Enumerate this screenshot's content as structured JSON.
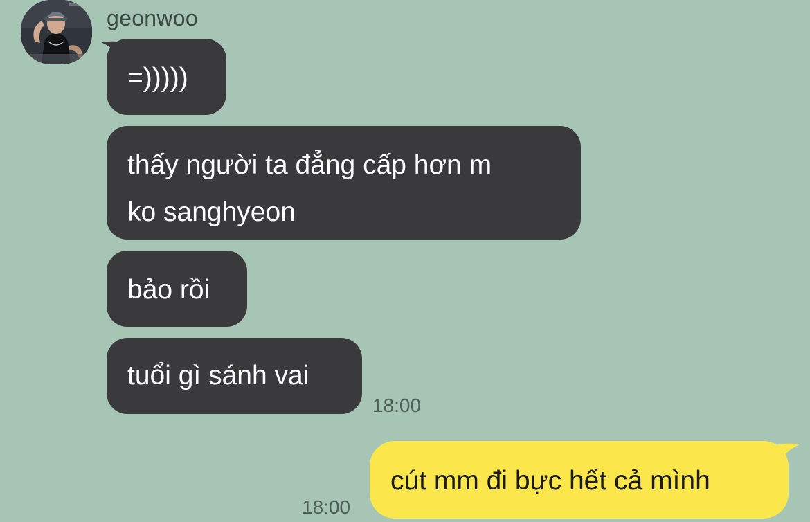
{
  "sender": {
    "name": "geonwoo"
  },
  "messages": [
    {
      "direction": "incoming",
      "text": "=)))))"
    },
    {
      "direction": "incoming",
      "line1": "thấy người ta đẳng cấp hơn m",
      "line2": "ko sanghyeon"
    },
    {
      "direction": "incoming",
      "text": "bảo rồi"
    },
    {
      "direction": "incoming",
      "text": "tuổi gì sánh vai",
      "time": "18:00"
    },
    {
      "direction": "outgoing",
      "text": "cút mm đi bực hết cả mình",
      "time": "18:00"
    }
  ],
  "colors": {
    "background": "#a7c5b5",
    "incoming_bubble": "#3a3a3c",
    "outgoing_bubble": "#fbe64b"
  }
}
